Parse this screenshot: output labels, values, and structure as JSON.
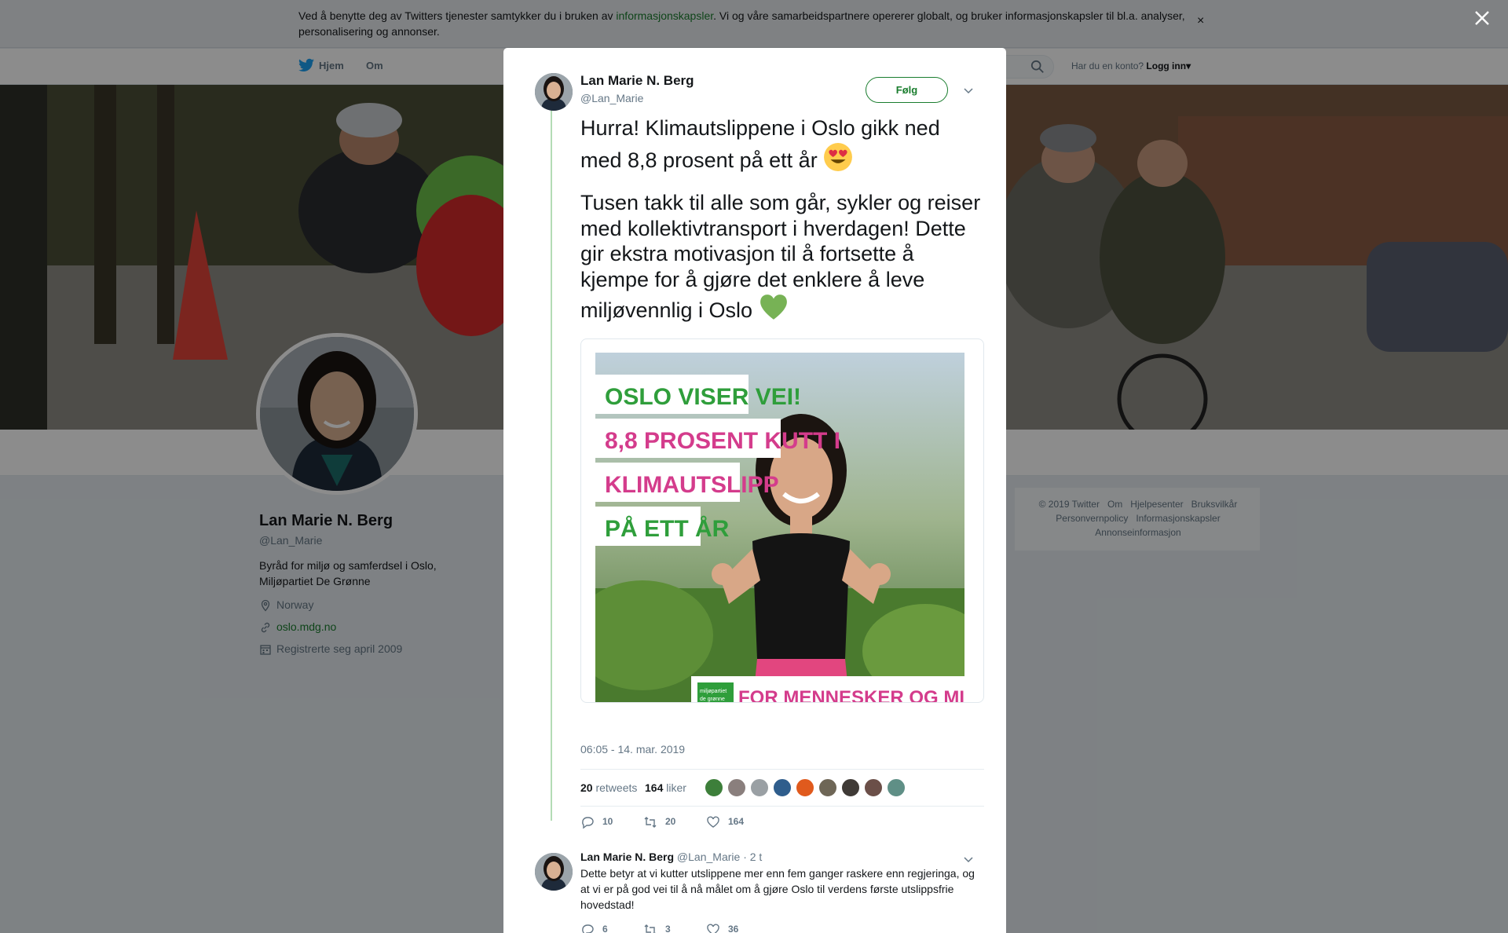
{
  "cookie_banner": {
    "text_before": "Ved å benytte deg av Twitters tjenester samtykker du i bruken av ",
    "link": "informasjonskapsler",
    "text_after": ". Vi og våre samarbeidspartnere opererer globalt, og bruker informasjonskapsler til bl.a. analyser, personalisering og annonser.",
    "close": "×"
  },
  "nav": {
    "home": "Hjem",
    "about": "Om",
    "account_prompt": "Har du en konto?",
    "login": "Logg inn",
    "login_caret": "▾"
  },
  "profile": {
    "name": "Lan Marie N. Berg",
    "handle": "@Lan_Marie",
    "bio": "Byråd for miljø og samferdsel i Oslo, Miljøpartiet De Grønne",
    "location": "Norway",
    "website": "oslo.mdg.no",
    "joined": "Registrerte seg april 2009"
  },
  "footer": {
    "links": [
      "© 2019 Twitter",
      "Om",
      "Hjelpesenter",
      "Bruksvilkår",
      "Personvernpolicy",
      "Informasjonskapsler",
      "Annonseinformasjon"
    ]
  },
  "tweet": {
    "author_name": "Lan Marie N. Berg",
    "author_handle": "@Lan_Marie",
    "follow_label": "Følg",
    "text_1": "Hurra! Klimautslippene i Oslo gikk ned med 8,8 prosent på ett år",
    "text_2": "Tusen takk til alle som går, sykler og reiser med kollektivtransport i hverdagen! Dette gir ekstra motivasjon til å fortsette å kjempe for å gjøre det enklere å leve miljøvennlig i Oslo",
    "media": {
      "line_1": "OSLO VISER VEI!",
      "line_2": "8,8 PROSENT KUTT I",
      "line_3": "KLIMAUTSLIPP",
      "line_4": "PÅ ETT ÅR",
      "logo_line_1": "miljøpartiet",
      "logo_line_2": "de grønne",
      "slogan": "FOR MENNESKER OG MILJØ"
    },
    "timestamp": "06:05 - 14. mar. 2019",
    "retweets_count": "20",
    "retweets_label": "retweets",
    "likes_count": "164",
    "likes_label": "liker",
    "actions": {
      "replies": "10",
      "retweets": "20",
      "likes": "164"
    }
  },
  "reply": {
    "author_name": "Lan Marie N. Berg",
    "author_handle": "@Lan_Marie",
    "time": "· 2 t",
    "text": "Dette betyr at vi kutter utslippene mer enn fem ganger raskere enn regjeringa, og at vi er på god vei til å nå målet om å gjøre Oslo til verdens første utslippsfrie hovedstad!",
    "actions": {
      "replies": "6",
      "retweets": "3",
      "likes": "36"
    }
  },
  "colors": {
    "accent_green": "#1a7d2e",
    "thread_line": "#b3dcb5",
    "overlay": "rgba(0,0,0,0.45)",
    "slogan_pink": "#d43c8c",
    "headline_green": "#2f9e3b"
  },
  "icons": [
    "twitter-bird-icon",
    "search-icon",
    "close-icon",
    "location-icon",
    "link-icon",
    "calendar-icon",
    "chevron-down-icon",
    "reply-icon",
    "retweet-icon",
    "heart-icon",
    "smiling-face-with-heart-eyes-emoji",
    "green-heart-emoji"
  ]
}
